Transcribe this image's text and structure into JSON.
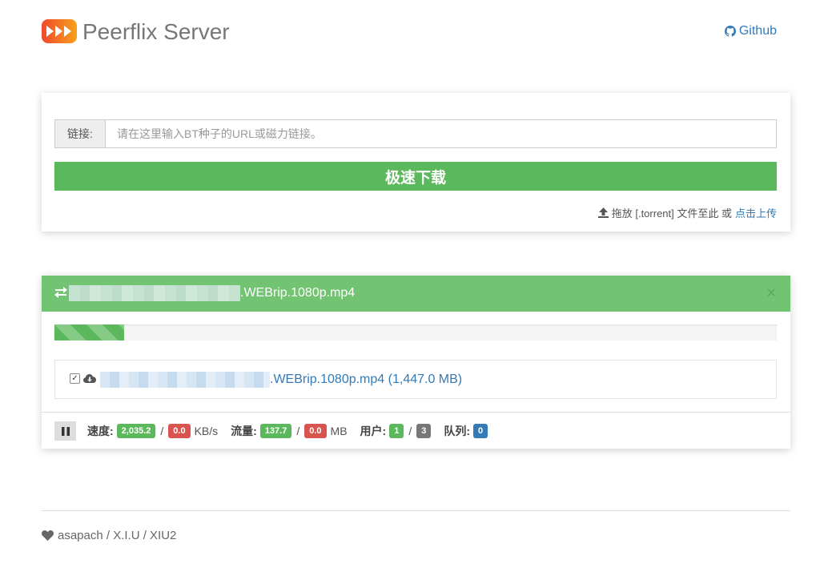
{
  "header": {
    "brand": "Peerflix Server",
    "github_label": "Github",
    "logo_color_start": "#f0492c",
    "logo_color_end": "#f7a11c"
  },
  "add_form": {
    "input_addon": "链接:",
    "input_placeholder": "请在这里输入BT种子的URL或磁力链接。",
    "input_value": "",
    "submit_label": "极速下载",
    "drop_hint": "拖放 [.torrent] 文件至此 或",
    "upload_link": "点击上传"
  },
  "torrent": {
    "name_suffix": ".WEBrip.1080p.mp4",
    "close_label": "×",
    "progress": 0.097,
    "file": {
      "name_suffix": ".WEBrip.1080p.mp4",
      "size": "(1,447.0 MB)",
      "checked": true
    },
    "stats": {
      "speed_label": "速度:",
      "speed_down": "2,035.2",
      "speed_up": "0.0",
      "speed_unit": "KB/s",
      "traffic_label": "流量:",
      "traffic_down": "137.7",
      "traffic_up": "0.0",
      "traffic_unit": "MB",
      "peers_label": "用户:",
      "peers_active": "1",
      "peers_total": "3",
      "queue_label": "队列:",
      "queue": "0",
      "slash": "/"
    }
  },
  "footer": {
    "credits": "asapach / X.I.U / XIU2"
  },
  "colors": {
    "success": "#5cb85c",
    "danger": "#d9534f",
    "primary": "#337ab7",
    "default": "#777777",
    "panel_header": "#72c472"
  }
}
